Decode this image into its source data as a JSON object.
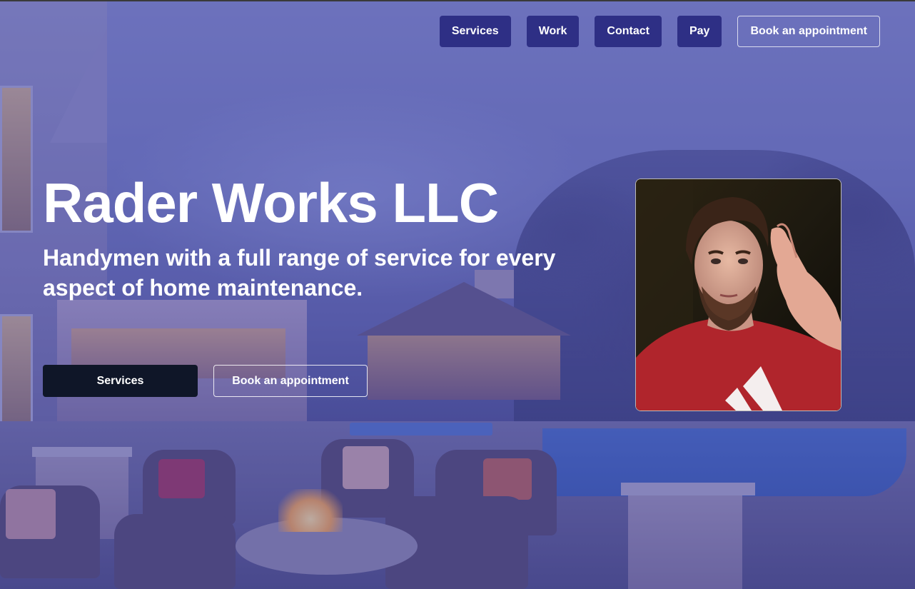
{
  "nav": {
    "items": [
      {
        "label": "Services"
      },
      {
        "label": "Work"
      },
      {
        "label": "Contact"
      },
      {
        "label": "Pay"
      }
    ],
    "book_label": "Book an appointment"
  },
  "hero": {
    "title": "Rader Works LLC",
    "subtitle": "Handymen with a full range of service for every aspect of home maintenance.",
    "primary_cta": "Services",
    "secondary_cta": "Book an appointment"
  },
  "colors": {
    "nav_button": "#2e2f85",
    "primary_cta": "#0f1628",
    "overlay": "#4e52aa",
    "text": "#ffffff"
  }
}
